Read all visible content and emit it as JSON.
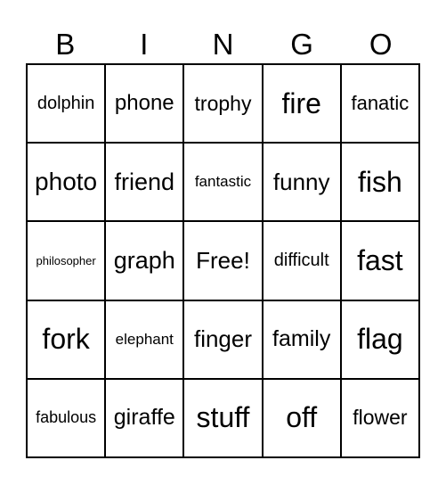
{
  "title_letters": [
    "B",
    "I",
    "N",
    "G",
    "O"
  ],
  "cells": [
    [
      {
        "text": "dolphin",
        "size": 20
      },
      {
        "text": "phone",
        "size": 24
      },
      {
        "text": "trophy",
        "size": 23
      },
      {
        "text": "fire",
        "size": 32
      },
      {
        "text": "fanatic",
        "size": 22
      }
    ],
    [
      {
        "text": "photo",
        "size": 28
      },
      {
        "text": "friend",
        "size": 27
      },
      {
        "text": "fantastic",
        "size": 17
      },
      {
        "text": "funny",
        "size": 26
      },
      {
        "text": "fish",
        "size": 32
      }
    ],
    [
      {
        "text": "philosopher",
        "size": 13
      },
      {
        "text": "graph",
        "size": 27
      },
      {
        "text": "Free!",
        "size": 26
      },
      {
        "text": "difficult",
        "size": 20
      },
      {
        "text": "fast",
        "size": 32
      }
    ],
    [
      {
        "text": "fork",
        "size": 32
      },
      {
        "text": "elephant",
        "size": 17
      },
      {
        "text": "finger",
        "size": 26
      },
      {
        "text": "family",
        "size": 25
      },
      {
        "text": "flag",
        "size": 32
      }
    ],
    [
      {
        "text": "fabulous",
        "size": 18
      },
      {
        "text": "giraffe",
        "size": 25
      },
      {
        "text": "stuff",
        "size": 32
      },
      {
        "text": "off",
        "size": 32
      },
      {
        "text": "flower",
        "size": 23
      }
    ]
  ]
}
